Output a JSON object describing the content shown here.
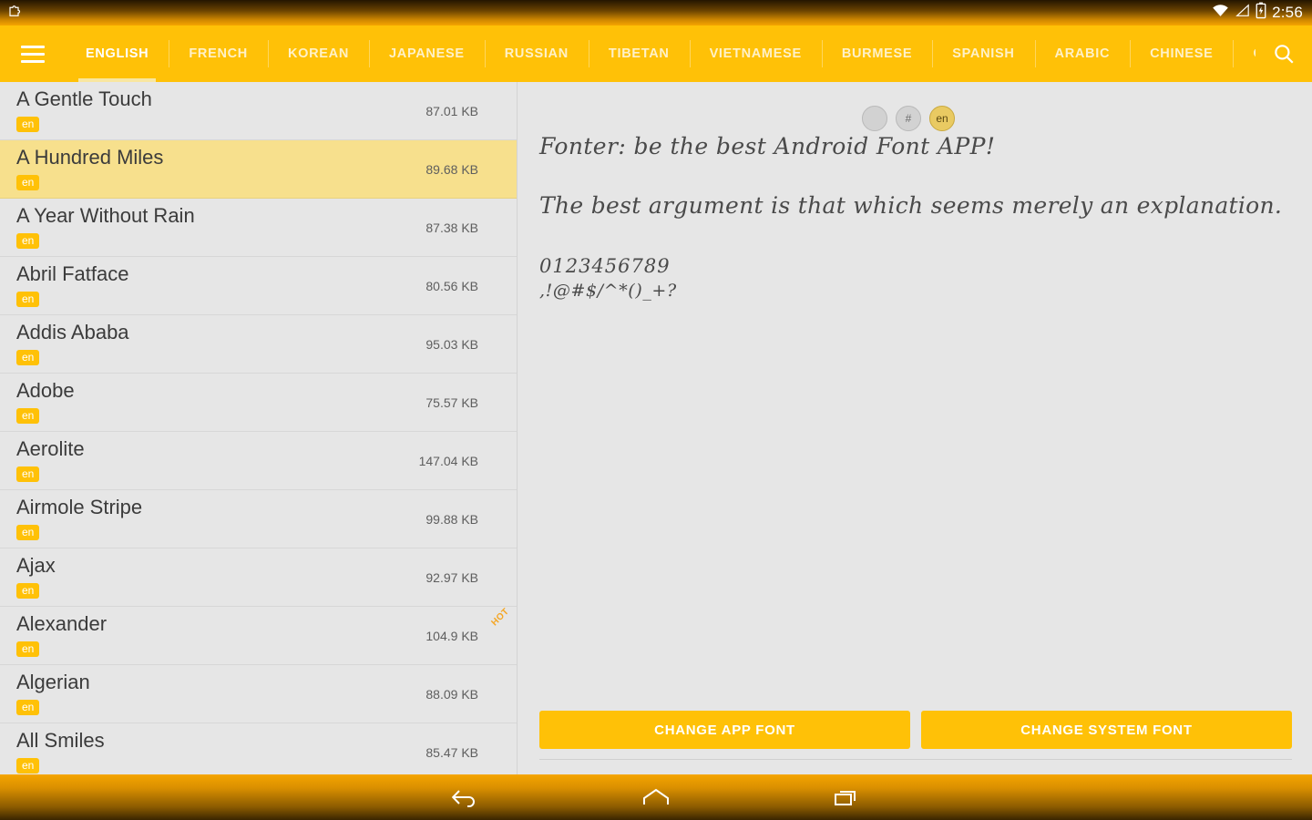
{
  "status_bar": {
    "notification_icon": "puzzle-piece-icon",
    "wifi_icon": "wifi-icon",
    "signal_icon": "signal-icon",
    "battery_icon": "battery-charging-icon",
    "clock": "2:56"
  },
  "toolbar": {
    "menu_icon": "hamburger-menu-icon",
    "search_icon": "search-icon",
    "tabs": [
      {
        "label": "ENGLISH",
        "active": true
      },
      {
        "label": "FRENCH",
        "active": false
      },
      {
        "label": "KOREAN",
        "active": false
      },
      {
        "label": "JAPANESE",
        "active": false
      },
      {
        "label": "RUSSIAN",
        "active": false
      },
      {
        "label": "TIBETAN",
        "active": false
      },
      {
        "label": "VIETNAMESE",
        "active": false
      },
      {
        "label": "BURMESE",
        "active": false
      },
      {
        "label": "SPANISH",
        "active": false
      },
      {
        "label": "ARABIC",
        "active": false
      },
      {
        "label": "CHINESE",
        "active": false
      },
      {
        "label": "CHINE",
        "active": false
      }
    ]
  },
  "font_list": [
    {
      "name": "A Gentle Touch",
      "lang": "en",
      "size": "87.01 KB",
      "selected": false,
      "hot": false
    },
    {
      "name": "A Hundred Miles",
      "lang": "en",
      "size": "89.68 KB",
      "selected": true,
      "hot": false
    },
    {
      "name": "A Year Without Rain",
      "lang": "en",
      "size": "87.38 KB",
      "selected": false,
      "hot": false
    },
    {
      "name": "Abril Fatface",
      "lang": "en",
      "size": "80.56 KB",
      "selected": false,
      "hot": false
    },
    {
      "name": "Addis Ababa",
      "lang": "en",
      "size": "95.03 KB",
      "selected": false,
      "hot": false
    },
    {
      "name": "Adobe",
      "lang": "en",
      "size": "75.57 KB",
      "selected": false,
      "hot": false
    },
    {
      "name": "Aerolite",
      "lang": "en",
      "size": "147.04 KB",
      "selected": false,
      "hot": false
    },
    {
      "name": "Airmole Stripe",
      "lang": "en",
      "size": "99.88 KB",
      "selected": false,
      "hot": false
    },
    {
      "name": "Ajax",
      "lang": "en",
      "size": "92.97 KB",
      "selected": false,
      "hot": false
    },
    {
      "name": "Alexander",
      "lang": "en",
      "size": "104.9 KB",
      "selected": false,
      "hot": true
    },
    {
      "name": "Algerian",
      "lang": "en",
      "size": "88.09 KB",
      "selected": false,
      "hot": false
    },
    {
      "name": "All Smiles",
      "lang": "en",
      "size": "85.47 KB",
      "selected": false,
      "hot": false
    }
  ],
  "preview": {
    "toggles": [
      {
        "label": "",
        "name": "preview-toggle-blank",
        "active": false
      },
      {
        "label": "#",
        "name": "preview-toggle-symbols",
        "active": false
      },
      {
        "label": "en",
        "name": "preview-toggle-english",
        "active": true
      }
    ],
    "line1": "Fonter: be the best Android Font APP!",
    "line2": "The best argument is that which seems merely an explanation.",
    "line3": "0123456789",
    "line4": ",!@#$/^*()_+?"
  },
  "actions": {
    "change_app_font": "CHANGE APP FONT",
    "change_system_font": "CHANGE SYSTEM FONT"
  },
  "nav_bar": {
    "back": "back-icon",
    "home": "home-icon",
    "recents": "recents-icon"
  },
  "colors": {
    "accent": "#ffc107",
    "selected_row": "#f7e08d",
    "background": "#e6e6e6",
    "hot_badge": "#f5a623"
  }
}
